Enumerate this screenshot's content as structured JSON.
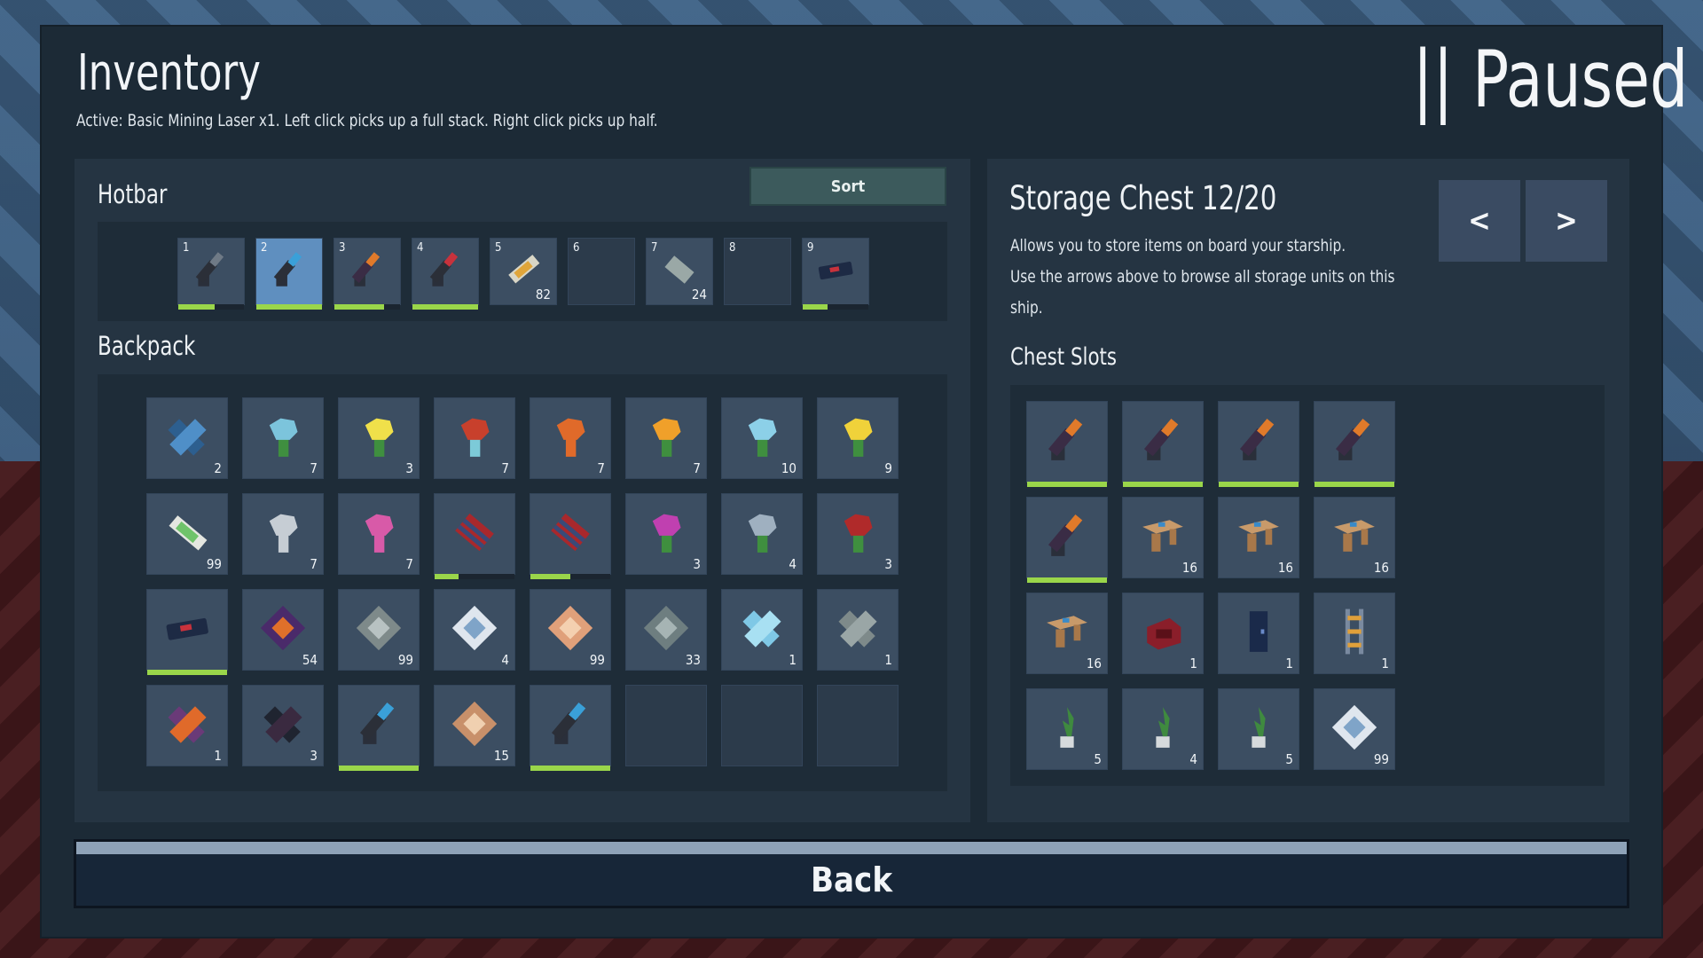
{
  "header": {
    "title": "Inventory",
    "subtitle": "Active: Basic Mining Laser x1. Left click picks up a full stack. Right click picks up half.",
    "paused_label": "|| Paused"
  },
  "hotbar": {
    "label": "Hotbar",
    "sort_label": "Sort",
    "slots": [
      {
        "num": "1",
        "icon": "mining-laser-dark-icon",
        "count": "",
        "durability": 0.55,
        "selected": false
      },
      {
        "num": "2",
        "icon": "mining-laser-blue-icon",
        "count": "",
        "durability": 1.0,
        "selected": true
      },
      {
        "num": "3",
        "icon": "mining-laser-orange-icon",
        "count": "",
        "durability": 0.75,
        "selected": false
      },
      {
        "num": "4",
        "icon": "mining-laser-red-icon",
        "count": "",
        "durability": 1.0,
        "selected": false
      },
      {
        "num": "5",
        "icon": "ammo-clip-icon",
        "count": "82",
        "durability": null,
        "selected": false
      },
      {
        "num": "6",
        "icon": "",
        "count": "",
        "durability": null,
        "selected": false
      },
      {
        "num": "7",
        "icon": "metal-plate-icon",
        "count": "24",
        "durability": null,
        "selected": false
      },
      {
        "num": "8",
        "icon": "",
        "count": "",
        "durability": null,
        "selected": false
      },
      {
        "num": "9",
        "icon": "grapple-tool-icon",
        "count": "",
        "durability": 0.38,
        "selected": false
      }
    ]
  },
  "backpack": {
    "label": "Backpack",
    "slots": [
      {
        "icon": "blue-crystal-icon",
        "count": "2",
        "durability": null
      },
      {
        "icon": "light-blue-flower-icon",
        "count": "7",
        "durability": null
      },
      {
        "icon": "yellow-flower-icon",
        "count": "3",
        "durability": null
      },
      {
        "icon": "red-flower-icon",
        "count": "7",
        "durability": null
      },
      {
        "icon": "orange-flower-icon",
        "count": "7",
        "durability": null
      },
      {
        "icon": "orange-bloom-icon",
        "count": "7",
        "durability": null
      },
      {
        "icon": "cyan-flower-icon",
        "count": "10",
        "durability": null
      },
      {
        "icon": "yellow-bloom-icon",
        "count": "9",
        "durability": null
      },
      {
        "icon": "ammo-clip-green-icon",
        "count": "99",
        "durability": null
      },
      {
        "icon": "grey-flower-icon",
        "count": "7",
        "durability": null
      },
      {
        "icon": "pink-flower-icon",
        "count": "7",
        "durability": null
      },
      {
        "icon": "striped-battery-icon",
        "count": "",
        "durability": 0.3
      },
      {
        "icon": "striped-battery-icon",
        "count": "",
        "durability": 0.5
      },
      {
        "icon": "magenta-flower-icon",
        "count": "3",
        "durability": null
      },
      {
        "icon": "steel-flower-icon",
        "count": "4",
        "durability": null
      },
      {
        "icon": "crimson-flower-icon",
        "count": "3",
        "durability": null
      },
      {
        "icon": "grapple-tool-icon",
        "count": "",
        "durability": 1.0
      },
      {
        "icon": "purple-gem-icon",
        "count": "54",
        "durability": null
      },
      {
        "icon": "grey-gem-icon",
        "count": "99",
        "durability": null
      },
      {
        "icon": "white-gem-icon",
        "count": "4",
        "durability": null
      },
      {
        "icon": "peach-gem-icon",
        "count": "99",
        "durability": null
      },
      {
        "icon": "slate-gem-icon",
        "count": "33",
        "durability": null
      },
      {
        "icon": "ice-crystal-icon",
        "count": "1",
        "durability": null
      },
      {
        "icon": "grey-crystal-icon",
        "count": "1",
        "durability": null
      },
      {
        "icon": "purple-orange-crystal-icon",
        "count": "1",
        "durability": null
      },
      {
        "icon": "dark-crystal-icon",
        "count": "3",
        "durability": null
      },
      {
        "icon": "mining-laser-blue-icon",
        "count": "",
        "durability": 1.0
      },
      {
        "icon": "tan-gem-icon",
        "count": "15",
        "durability": null
      },
      {
        "icon": "mining-laser-blue-icon",
        "count": "",
        "durability": 1.0
      },
      {
        "icon": "",
        "count": "",
        "durability": null
      },
      {
        "icon": "",
        "count": "",
        "durability": null
      },
      {
        "icon": "",
        "count": "",
        "durability": null
      }
    ]
  },
  "chest": {
    "title": "Storage Chest 12/20",
    "desc_line1": "Allows you to store items on board your starship.",
    "desc_line2": "Use the arrows above to browse all storage units on this",
    "desc_line3": "ship.",
    "prev_label": "<",
    "next_label": ">",
    "slots_label": "Chest Slots",
    "slots": [
      {
        "icon": "mining-laser-orange-icon",
        "count": "",
        "durability": 1.0
      },
      {
        "icon": "mining-laser-orange-icon",
        "count": "",
        "durability": 1.0
      },
      {
        "icon": "mining-laser-orange-icon",
        "count": "",
        "durability": 1.0
      },
      {
        "icon": "mining-laser-orange-icon",
        "count": "",
        "durability": 1.0
      },
      {
        "icon": "mining-laser-orange-icon",
        "count": "",
        "durability": 1.0
      },
      {
        "icon": "table-icon",
        "count": "16",
        "durability": null
      },
      {
        "icon": "table-icon",
        "count": "16",
        "durability": null
      },
      {
        "icon": "table-icon",
        "count": "16",
        "durability": null
      },
      {
        "icon": "table-icon",
        "count": "16",
        "durability": null
      },
      {
        "icon": "armchair-icon",
        "count": "1",
        "durability": null
      },
      {
        "icon": "door-icon",
        "count": "1",
        "durability": null
      },
      {
        "icon": "ladder-icon",
        "count": "1",
        "durability": null
      },
      {
        "icon": "potted-plant-icon",
        "count": "5",
        "durability": null
      },
      {
        "icon": "potted-plant-icon",
        "count": "4",
        "durability": null
      },
      {
        "icon": "potted-plant-icon",
        "count": "5",
        "durability": null
      },
      {
        "icon": "white-gem-icon",
        "count": "99",
        "durability": null
      }
    ]
  },
  "footer": {
    "back_label": "Back"
  },
  "colors": {
    "panel": "#253442",
    "slot": "#3c4e62",
    "selected_slot": "#5f8fbf",
    "durability": "#9ad64a",
    "sort_button": "#3c5a5c"
  }
}
